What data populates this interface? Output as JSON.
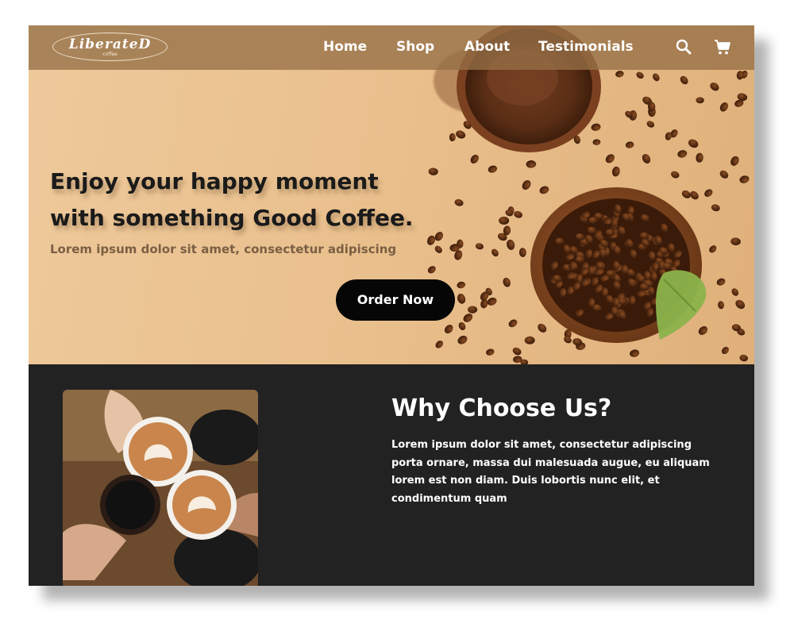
{
  "nav": {
    "logo_text": "LiberateD",
    "logo_subtext": "coffee",
    "links": [
      "Home",
      "Shop",
      "About",
      "Testimonials"
    ],
    "icons": [
      "search-icon",
      "cart-icon"
    ]
  },
  "hero": {
    "headline_line1": "Enjoy your happy moment",
    "headline_line2": "with something Good Coffee.",
    "subheadline": "Lorem ipsum dolor sit amet, consectetur adipiscing",
    "cta_label": "Order Now"
  },
  "why": {
    "title": "Why Choose Us?",
    "body": "Lorem ipsum dolor sit amet, consectetur adipiscing porta ornare, massa dui malesuada augue, eu aliquam lorem est non diam. Duis lobortis nunc elit, et condimentum quam"
  },
  "colors": {
    "hero_bg": "#e9bf8c",
    "navbar_bg": "#96704a",
    "button_bg": "#060606",
    "section_bg": "#222222",
    "subheadline": "#7b5f43"
  }
}
